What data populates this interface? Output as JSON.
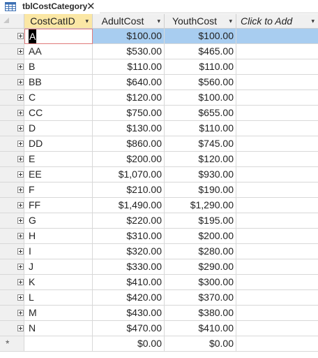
{
  "tab": {
    "title": "tblCostCategory",
    "close_label": "✕"
  },
  "columns": [
    {
      "label": "CostCatID"
    },
    {
      "label": "AdultCost"
    },
    {
      "label": "YouthCost"
    },
    {
      "label": "Click to Add"
    }
  ],
  "dropdown_glyph": "▾",
  "rows": [
    {
      "id": "A",
      "adult": "$100.00",
      "youth": "$100.00"
    },
    {
      "id": "AA",
      "adult": "$530.00",
      "youth": "$465.00"
    },
    {
      "id": "B",
      "adult": "$110.00",
      "youth": "$110.00"
    },
    {
      "id": "BB",
      "adult": "$640.00",
      "youth": "$560.00"
    },
    {
      "id": "C",
      "adult": "$120.00",
      "youth": "$100.00"
    },
    {
      "id": "CC",
      "adult": "$750.00",
      "youth": "$655.00"
    },
    {
      "id": "D",
      "adult": "$130.00",
      "youth": "$110.00"
    },
    {
      "id": "DD",
      "adult": "$860.00",
      "youth": "$745.00"
    },
    {
      "id": "E",
      "adult": "$200.00",
      "youth": "$120.00"
    },
    {
      "id": "EE",
      "adult": "$1,070.00",
      "youth": "$930.00"
    },
    {
      "id": "F",
      "adult": "$210.00",
      "youth": "$190.00"
    },
    {
      "id": "FF",
      "adult": "$1,490.00",
      "youth": "$1,290.00"
    },
    {
      "id": "G",
      "adult": "$220.00",
      "youth": "$195.00"
    },
    {
      "id": "H",
      "adult": "$310.00",
      "youth": "$200.00"
    },
    {
      "id": "I",
      "adult": "$320.00",
      "youth": "$280.00"
    },
    {
      "id": "J",
      "adult": "$330.00",
      "youth": "$290.00"
    },
    {
      "id": "K",
      "adult": "$410.00",
      "youth": "$300.00"
    },
    {
      "id": "L",
      "adult": "$420.00",
      "youth": "$370.00"
    },
    {
      "id": "M",
      "adult": "$430.00",
      "youth": "$380.00"
    },
    {
      "id": "N",
      "adult": "$470.00",
      "youth": "$410.00"
    }
  ],
  "new_row": {
    "marker": "*",
    "adult": "$0.00",
    "youth": "$0.00"
  }
}
